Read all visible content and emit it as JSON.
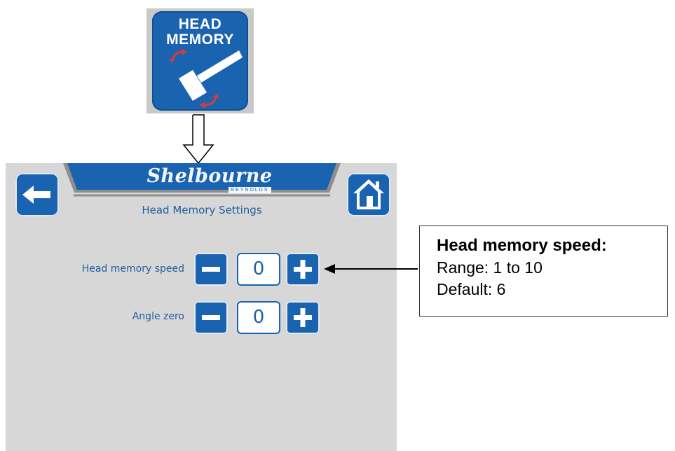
{
  "icon_tile": {
    "line1": "HEAD",
    "line2": "MEMORY"
  },
  "header": {
    "logo_main": "Shelbourne",
    "logo_sub": "REYNOLDS",
    "title": "Head Memory Settings"
  },
  "settings": [
    {
      "label": "Head memory speed",
      "value": "0"
    },
    {
      "label": "Angle zero",
      "value": "0"
    }
  ],
  "callout": {
    "title": "Head memory speed:",
    "range": "Range: 1 to 10",
    "default": "Default: 6"
  },
  "colors": {
    "brand_blue": "#1a63b0",
    "screen_bg": "#d7d7d7",
    "label_text": "#1f5f9f"
  },
  "icons": {
    "back": "arrow-left-icon",
    "home": "home-icon",
    "minus": "minus-icon",
    "plus": "plus-icon"
  }
}
